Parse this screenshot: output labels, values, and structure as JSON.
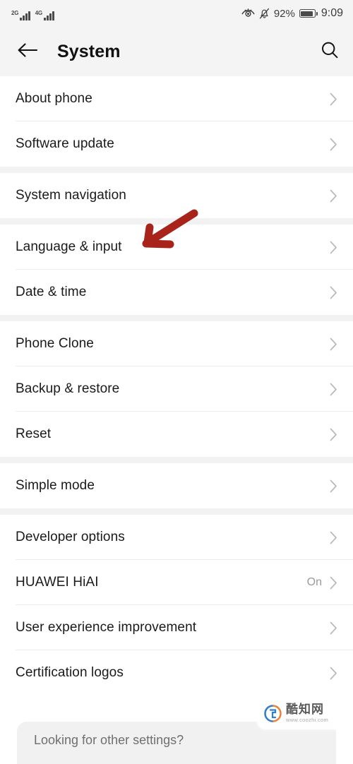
{
  "status_bar": {
    "sim1_network": "2G",
    "sim2_network": "4G",
    "battery_percent": "92%",
    "time": "9:09",
    "icons": [
      "eye-comfort-icon",
      "bell-muted-icon",
      "battery-icon"
    ]
  },
  "header": {
    "title": "System",
    "back_icon": "back-arrow-icon",
    "search_icon": "search-icon"
  },
  "groups": [
    {
      "rows": [
        {
          "label": "About phone",
          "value": ""
        },
        {
          "label": "Software update",
          "value": ""
        }
      ]
    },
    {
      "rows": [
        {
          "label": "System navigation",
          "value": ""
        }
      ]
    },
    {
      "rows": [
        {
          "label": "Language & input",
          "value": ""
        },
        {
          "label": "Date & time",
          "value": ""
        }
      ]
    },
    {
      "rows": [
        {
          "label": "Phone Clone",
          "value": ""
        },
        {
          "label": "Backup & restore",
          "value": ""
        },
        {
          "label": "Reset",
          "value": ""
        }
      ]
    },
    {
      "rows": [
        {
          "label": "Simple mode",
          "value": ""
        }
      ]
    },
    {
      "rows": [
        {
          "label": "Developer options",
          "value": ""
        },
        {
          "label": "HUAWEI HiAI",
          "value": "On"
        },
        {
          "label": "User experience improvement",
          "value": ""
        },
        {
          "label": "Certification logos",
          "value": ""
        }
      ]
    }
  ],
  "annotation": {
    "shape": "arrow-down-left",
    "color": "#a8231a",
    "points_at": "Language & input"
  },
  "watermark": {
    "name": "酷知网",
    "url": "www.coozhi.com"
  },
  "bottom_card": {
    "text": "Looking for other settings?"
  },
  "colors": {
    "bar_background": "#f4f4f4",
    "page_background": "#ffffff",
    "group_gap": "#f2f2f2",
    "divider": "#ededed",
    "primary_text": "#1a1a1a",
    "secondary_text": "#9a9a9a",
    "annotation_red": "#a8231a"
  }
}
